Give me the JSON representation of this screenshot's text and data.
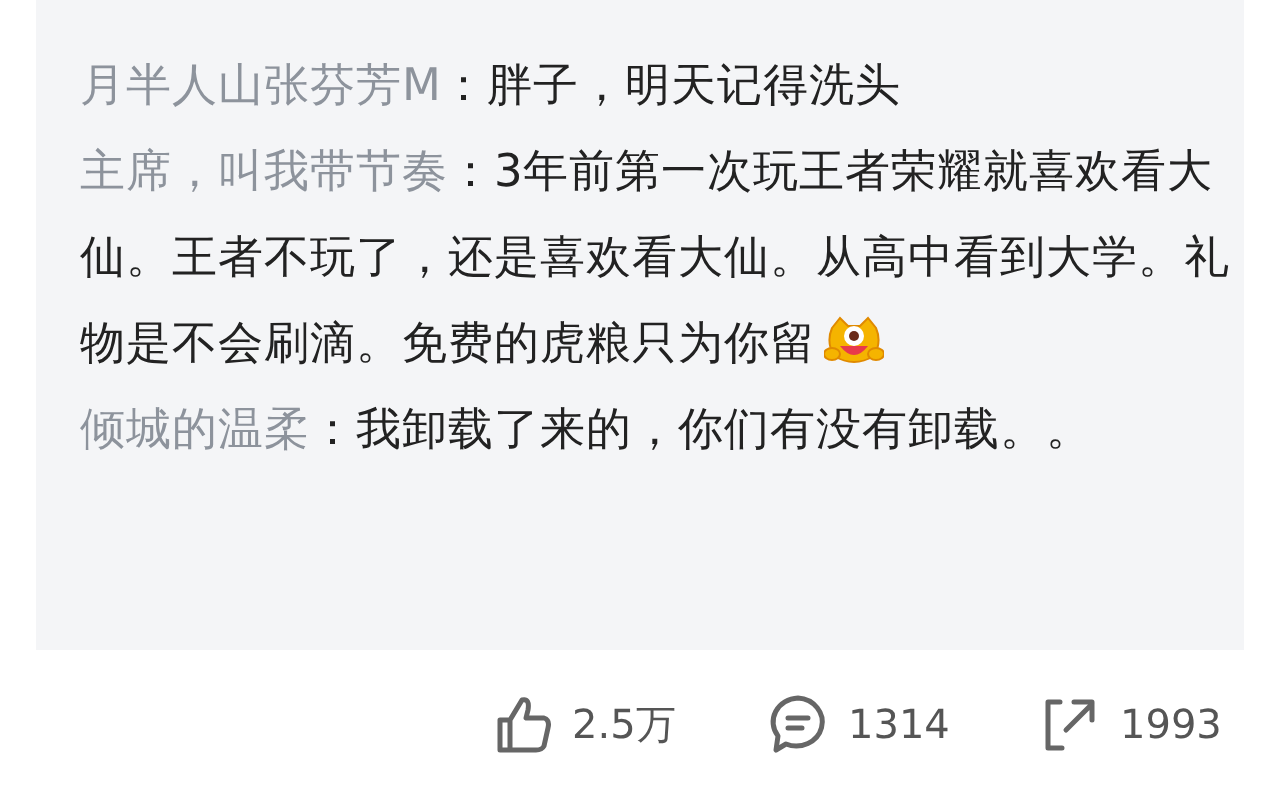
{
  "comments": [
    {
      "user": "月半人山张芬芳M",
      "text": "：胖子，明天记得洗头",
      "emoji": false
    },
    {
      "user": "主席，叫我带节奏",
      "text": "：3年前第一次玩王者荣耀就喜欢看大仙。王者不玩了，还是喜欢看大仙。从高中看到大学。礼物是不会刷滴。免费的虎粮只为你留",
      "emoji": true
    },
    {
      "user": "倾城的温柔",
      "text": "：我卸载了来的，你们有没有卸载。。",
      "emoji": false
    }
  ],
  "stats": [
    {
      "kind": "like",
      "count": "2.5万"
    },
    {
      "kind": "comment",
      "count": "1314"
    },
    {
      "kind": "share",
      "count": "1993"
    }
  ]
}
